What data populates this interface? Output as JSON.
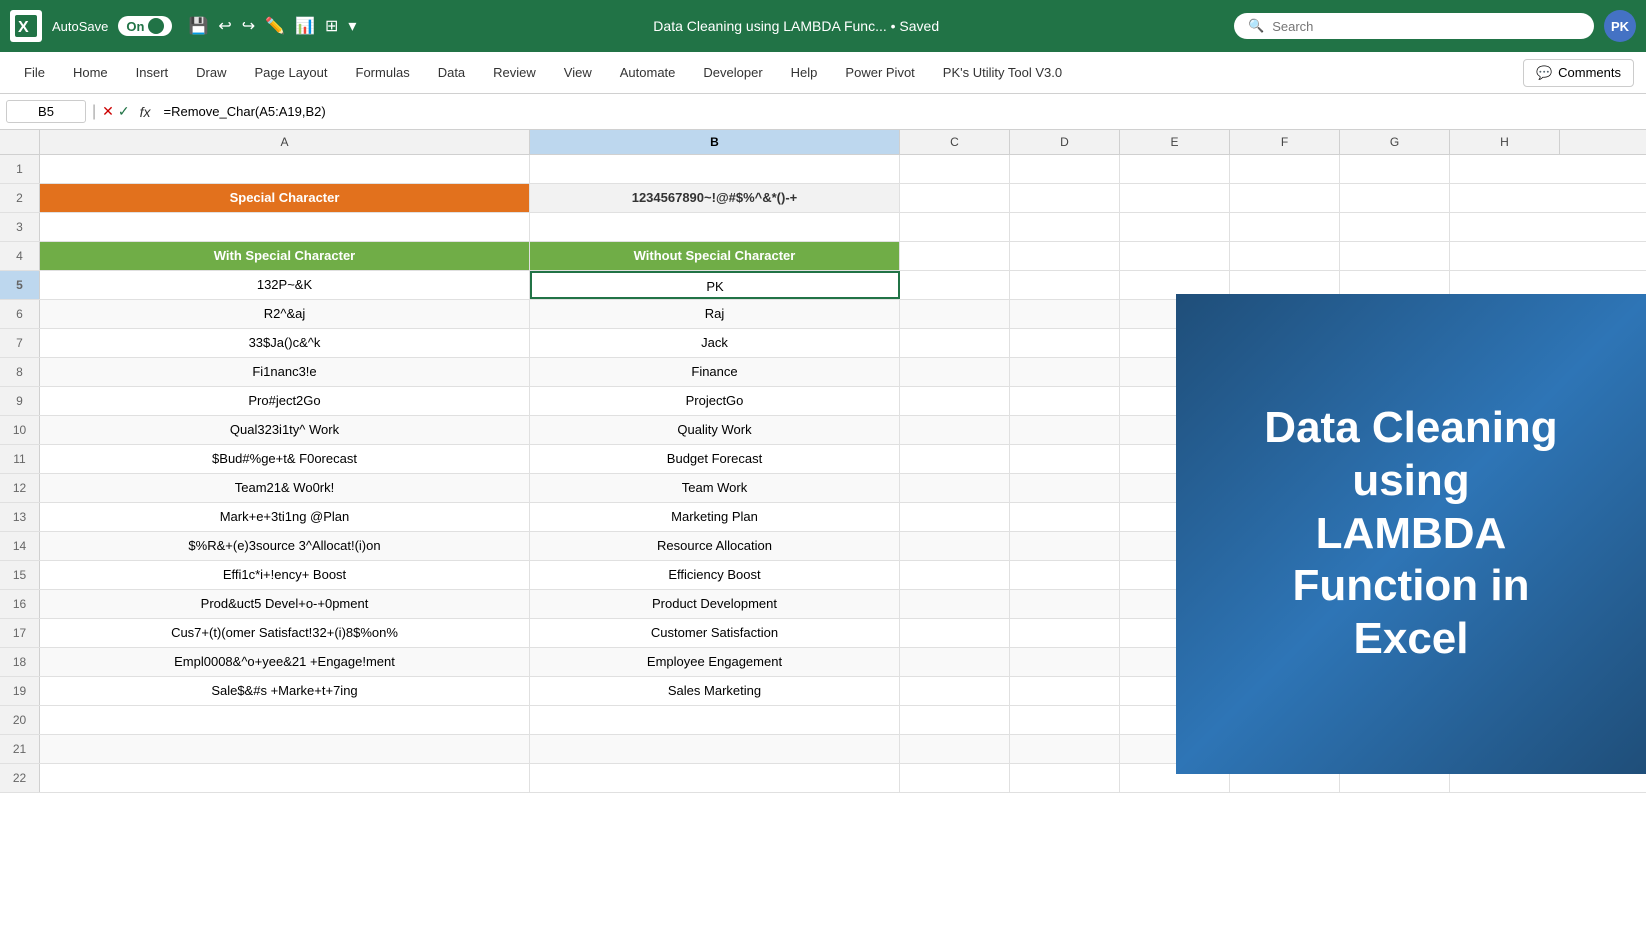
{
  "titleBar": {
    "excelLogo": "X",
    "autoSaveLabel": "AutoSave",
    "toggleState": "On",
    "docTitle": "Data Cleaning using LAMBDA Func... • Saved",
    "searchPlaceholder": "Search",
    "userInitials": "PK"
  },
  "menuBar": {
    "items": [
      "File",
      "Home",
      "Insert",
      "Draw",
      "Page Layout",
      "Formulas",
      "Data",
      "Review",
      "View",
      "Automate",
      "Developer",
      "Help",
      "Power Pivot",
      "PK's Utility Tool V3.0"
    ],
    "commentsLabel": "Comments"
  },
  "formulaBar": {
    "cellRef": "B5",
    "formula": "=Remove_Char(A5:A19,B2)"
  },
  "columns": {
    "headers": [
      "A",
      "B",
      "C",
      "D",
      "E",
      "F",
      "G",
      "H"
    ]
  },
  "rows": [
    {
      "num": 1,
      "a": "",
      "b": "",
      "c": "",
      "d": "",
      "e": "",
      "f": "",
      "g": "",
      "h": ""
    },
    {
      "num": 2,
      "a": "Special Character",
      "b": "1234567890~!@#$%^&*()-+",
      "c": "",
      "d": "",
      "e": "",
      "f": "",
      "g": "",
      "h": "",
      "aStyle": "orange-header",
      "bStyle": "b2-special"
    },
    {
      "num": 3,
      "a": "",
      "b": "",
      "c": "",
      "d": "",
      "e": "",
      "f": "",
      "g": "",
      "h": ""
    },
    {
      "num": 4,
      "a": "With Special Character",
      "b": "Without Special Character",
      "c": "",
      "d": "",
      "e": "",
      "f": "",
      "g": "",
      "h": "",
      "aStyle": "green-header",
      "bStyle": "green-header"
    },
    {
      "num": 5,
      "a": "132P~&K",
      "b": "PK",
      "active": true
    },
    {
      "num": 6,
      "a": "R2^&aj",
      "b": "Raj"
    },
    {
      "num": 7,
      "a": "33$Ja()c&^k",
      "b": "Jack"
    },
    {
      "num": 8,
      "a": "Fi1nanc3!e",
      "b": "Finance"
    },
    {
      "num": 9,
      "a": "Pro#ject2Go",
      "b": "ProjectGo"
    },
    {
      "num": 10,
      "a": "Qual323i1ty^ Work",
      "b": "Quality Work"
    },
    {
      "num": 11,
      "a": "$Bud#%ge+t& F0orecast",
      "b": "Budget Forecast"
    },
    {
      "num": 12,
      "a": "Team21& Wo0rk!",
      "b": "Team Work"
    },
    {
      "num": 13,
      "a": "Mark+e+3ti1ng @Plan",
      "b": "Marketing Plan"
    },
    {
      "num": 14,
      "a": "$%R&+(e)3source 3^Allocat!(i)on",
      "b": "Resource Allocation"
    },
    {
      "num": 15,
      "a": "Effi1c*i+!ency+ Boost",
      "b": "Efficiency Boost"
    },
    {
      "num": 16,
      "a": "Prod&uct5 Devel+o-+0pment",
      "b": "Product Development"
    },
    {
      "num": 17,
      "a": "Cus7+(t)(omer Satisfact!32+(i)8$%on%",
      "b": "Customer Satisfaction"
    },
    {
      "num": 18,
      "a": "Empl0008&^o+yee&21 +Engage!ment",
      "b": "Employee Engagement"
    },
    {
      "num": 19,
      "a": "Sale$&#s +Marke+t+7ing",
      "b": "Sales Marketing"
    },
    {
      "num": 20,
      "a": "",
      "b": ""
    },
    {
      "num": 21,
      "a": "",
      "b": ""
    },
    {
      "num": 22,
      "a": "",
      "b": ""
    }
  ],
  "sideImage": {
    "line1": "Data Cleaning",
    "line2": "using",
    "line3": "LAMBDA",
    "line4": "Function in",
    "line5": "Excel"
  }
}
